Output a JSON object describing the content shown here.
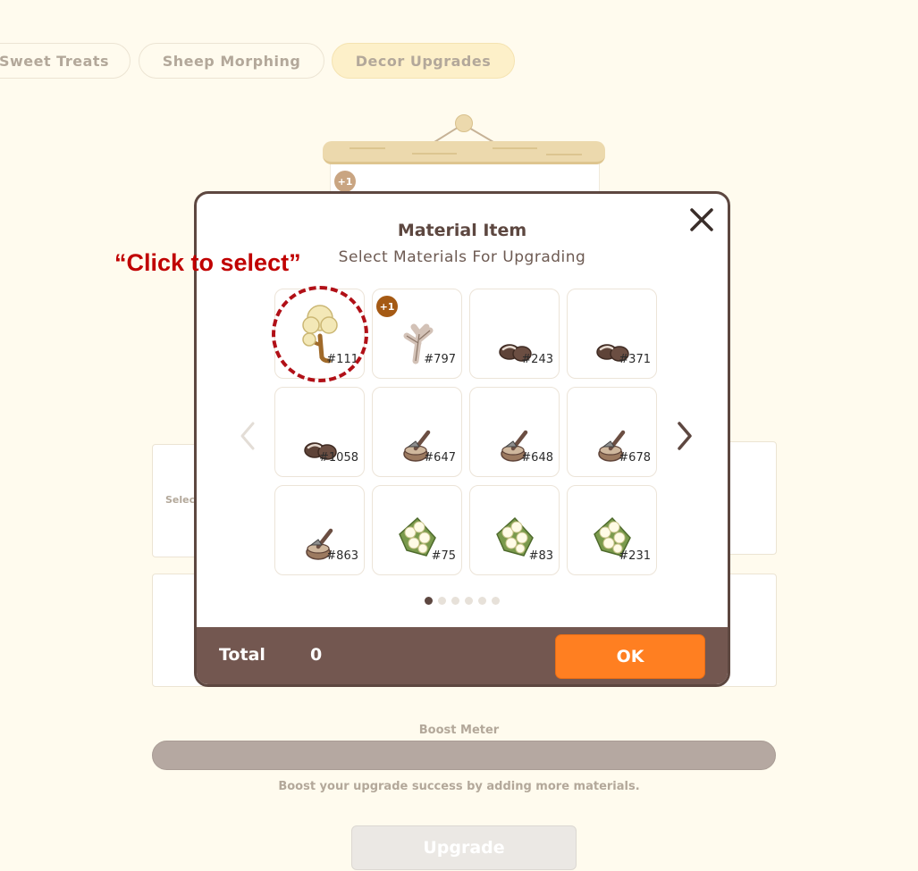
{
  "tabs": [
    {
      "label": "Sweet Treats",
      "active": false
    },
    {
      "label": "Sheep Morphing",
      "active": false
    },
    {
      "label": "Decor Upgrades",
      "active": true
    }
  ],
  "background": {
    "badge_text": "+1",
    "select_label_partial": "Selec",
    "boost_meter_label": "Boost Meter",
    "boost_meter_level": 0,
    "boost_hint": "Boost your upgrade success by adding more materials.",
    "upgrade_label": "Upgrade"
  },
  "modal": {
    "title": "Material Item",
    "subtitle": "Select Materials For Upgrading",
    "items": [
      {
        "id": "#111",
        "icon": "cotton-tree-icon"
      },
      {
        "id": "#797",
        "icon": "branch-icon",
        "badge": "+1"
      },
      {
        "id": "#243",
        "icon": "stones-icon"
      },
      {
        "id": "#371",
        "icon": "stones-icon"
      },
      {
        "id": "#1058",
        "icon": "stones-icon"
      },
      {
        "id": "#647",
        "icon": "axe-stump-icon"
      },
      {
        "id": "#648",
        "icon": "axe-stump-icon"
      },
      {
        "id": "#678",
        "icon": "axe-stump-icon"
      },
      {
        "id": "#863",
        "icon": "axe-stump-icon"
      },
      {
        "id": "#75",
        "icon": "flower-bush-icon"
      },
      {
        "id": "#83",
        "icon": "flower-bush-icon"
      },
      {
        "id": "#231",
        "icon": "flower-bush-icon"
      }
    ],
    "pages_total": 6,
    "current_page": 1,
    "total_label": "Total",
    "total_value": "0",
    "ok_label": "OK"
  },
  "annotation": {
    "text": "“Click to select”",
    "color": "#c00000"
  },
  "colors": {
    "page_bg": "#fffbee",
    "modal_border": "#5d4740",
    "footer_bg": "#735750",
    "ok_button": "#ff7f21",
    "badge_brown": "#a55a14",
    "boost_bar": "#b5a8a1"
  }
}
